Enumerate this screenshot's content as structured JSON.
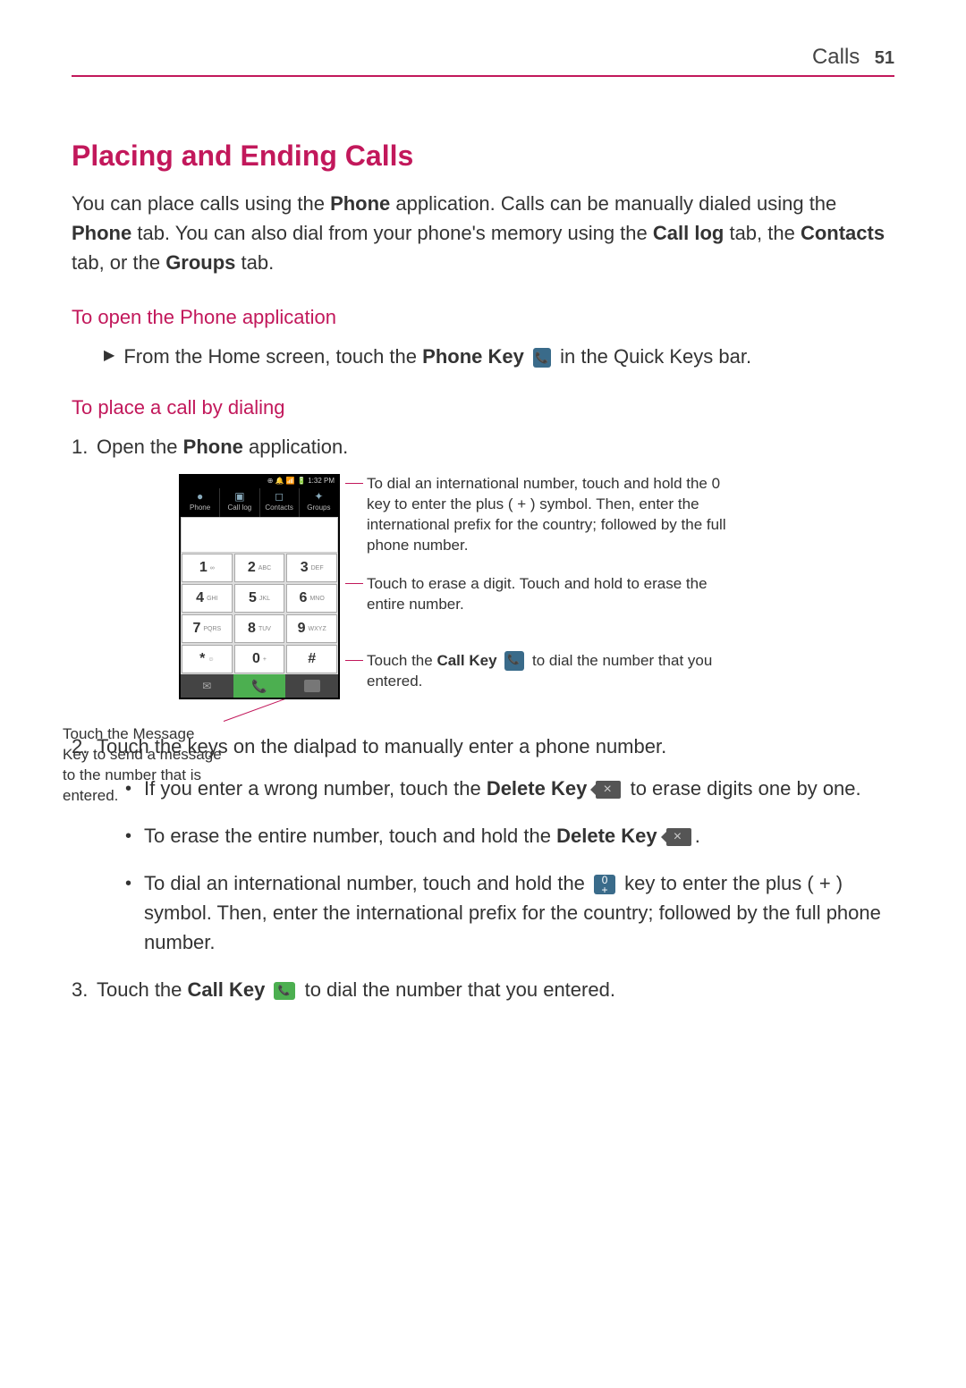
{
  "header": {
    "section": "Calls",
    "page": "51"
  },
  "title": "Placing and Ending Calls",
  "intro": {
    "p1a": "You can place calls using the ",
    "p1b": "Phone",
    "p1c": " application. Calls can be manually dialed using the ",
    "p1d": "Phone",
    "p1e": " tab. You can also dial from your phone's memory using the ",
    "p1f": "Call log",
    "p1g": " tab, the ",
    "p1h": "Contacts",
    "p1i": " tab, or the ",
    "p1j": "Groups",
    "p1k": " tab."
  },
  "h2a": "To open the Phone application",
  "step_open": {
    "a": "From the Home screen, touch the ",
    "b": "Phone Key",
    "c": " in the Quick Keys bar."
  },
  "h2b": "To place a call by dialing",
  "step1": {
    "n": "1.",
    "a": "Open the ",
    "b": "Phone",
    "c": " application."
  },
  "screenshot": {
    "status": "⊕ 🔔 📶 🔋 1:32 PM",
    "tabs": [
      {
        "icon": "●",
        "label": "Phone"
      },
      {
        "icon": "▣",
        "label": "Call log"
      },
      {
        "icon": "◻",
        "label": "Contacts"
      },
      {
        "icon": "✦",
        "label": "Groups"
      }
    ],
    "keys": [
      [
        {
          "d": "1",
          "s": "∞"
        },
        {
          "d": "2",
          "s": "ABC"
        },
        {
          "d": "3",
          "s": "DEF"
        }
      ],
      [
        {
          "d": "4",
          "s": "GHI"
        },
        {
          "d": "5",
          "s": "JKL"
        },
        {
          "d": "6",
          "s": "MNO"
        }
      ],
      [
        {
          "d": "7",
          "s": "PQRS"
        },
        {
          "d": "8",
          "s": "TUV"
        },
        {
          "d": "9",
          "s": "WXYZ"
        }
      ],
      [
        {
          "d": "*",
          "s": "☺"
        },
        {
          "d": "0",
          "s": "+"
        },
        {
          "d": "#",
          "s": ""
        }
      ]
    ]
  },
  "callout_left": "Touch the Message Key to send a message to the number that is entered.",
  "callout_r1": "To dial an international number, touch and hold the 0 key to enter the plus ( + ) symbol. Then, enter the international prefix for the country; followed by the full phone number.",
  "callout_r2": "Touch to erase a digit. Touch and hold to erase the entire number.",
  "callout_r3a": "Touch the ",
  "callout_r3b": "Call Key",
  "callout_r3c": " to dial the number that you entered.",
  "step2": {
    "n": "2.",
    "t": "Touch the keys on the dialpad to manually enter a phone number."
  },
  "b1": {
    "a": "If you enter a wrong number, touch the ",
    "b": "Delete Key",
    "c": " to erase digits one by one."
  },
  "b2": {
    "a": "To erase the entire number, touch and hold the ",
    "b": "Delete Key",
    "c": "."
  },
  "b3": {
    "a": "To dial an international number, touch and hold the ",
    "b": " key to enter the plus ( + ) symbol. Then, enter the international prefix for the country; followed by the full phone number."
  },
  "step3": {
    "n": "3.",
    "a": "Touch the ",
    "b": "Call Key",
    "c": " to dial the number that you entered."
  }
}
